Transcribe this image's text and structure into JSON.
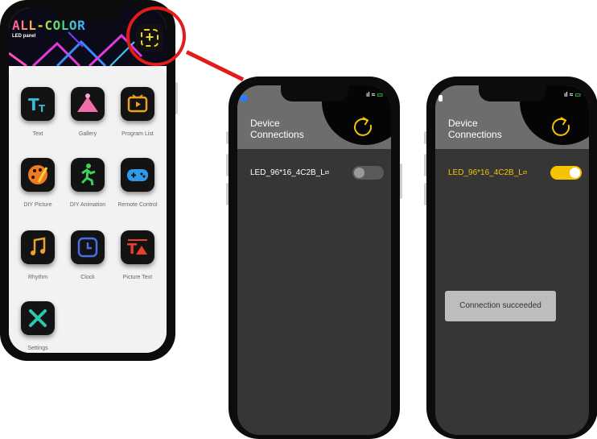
{
  "home": {
    "logo": "ALL-COLOR",
    "subtitle": "LED panel",
    "add_icon": "plus-square-icon",
    "apps": [
      {
        "label": "Text",
        "icon": "text-size-icon",
        "color": "#3bb7d6"
      },
      {
        "label": "Gallery",
        "icon": "mountain-icon",
        "color": "#f06fa8"
      },
      {
        "label": "Program List",
        "icon": "tv-icon",
        "color": "#f0a020"
      },
      {
        "label": "DIY Picture",
        "icon": "palette-icon",
        "color": "#f07a20"
      },
      {
        "label": "DIY Animation",
        "icon": "running-figure-icon",
        "color": "#3fd15a"
      },
      {
        "label": "Remote Control",
        "icon": "gamepad-icon",
        "color": "#2f9ae8"
      },
      {
        "label": "Rhythm",
        "icon": "music-note-icon",
        "color": "#f0a030"
      },
      {
        "label": "Clock",
        "icon": "clock-icon",
        "color": "#4a6ee8"
      },
      {
        "label": "Picture Text",
        "icon": "picture-text-icon",
        "color": "#e8402a"
      },
      {
        "label": "Settings",
        "icon": "wrench-screwdriver-icon",
        "color": "#2fc6b0"
      }
    ]
  },
  "connections_off": {
    "title_line1": "Device",
    "title_line2": "Connections",
    "device_name": "LED_96*16_4C2B_L",
    "toggle_on": false,
    "device_color": "#ffffff"
  },
  "connections_on": {
    "title_line1": "Device",
    "title_line2": "Connections",
    "device_name": "LED_96*16_4C2B_L",
    "toggle_on": true,
    "device_color": "#f5c400",
    "toast": "Connection succeeded"
  },
  "colors": {
    "accent_yellow": "#f5c400",
    "highlight_red": "#e31b1b"
  }
}
